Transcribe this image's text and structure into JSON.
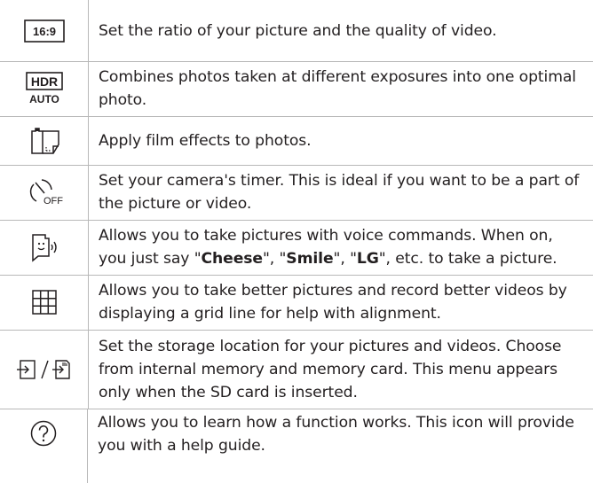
{
  "rows": [
    {
      "icon": "aspect-ratio-16-9-icon",
      "icon_text": "16:9",
      "text": "Set the ratio of your picture and the quality of video."
    },
    {
      "icon": "hdr-auto-icon",
      "icon_text_top": "HDR",
      "icon_text_bottom": "AUTO",
      "text": "Combines photos taken at different exposures into one optimal photo."
    },
    {
      "icon": "film-effect-icon",
      "text": "Apply film effects to photos."
    },
    {
      "icon": "timer-off-icon",
      "icon_text": "OFF",
      "text": "Set your camera's timer. This is ideal if you want to be a part of the picture or video."
    },
    {
      "icon": "voice-shutter-icon",
      "text_before": "Allows you to take pictures with voice commands. When on, you just say \"",
      "kw1": "Cheese",
      "sep1": "\", \"",
      "kw2": "Smile",
      "sep2": "\", \"",
      "kw3": "LG",
      "text_after": "\", etc. to take a picture."
    },
    {
      "icon": "grid-icon",
      "text": "Allows you to take better pictures and record better videos by displaying a grid line for help with alignment."
    },
    {
      "icon": "storage-location-icon",
      "text": "Set the storage location for your pictures and videos. Choose from internal memory and memory card. This menu appears only when the SD card is inserted."
    },
    {
      "icon": "help-icon",
      "text": "Allows you to learn how a function works. This icon will provide you with a help guide."
    }
  ]
}
